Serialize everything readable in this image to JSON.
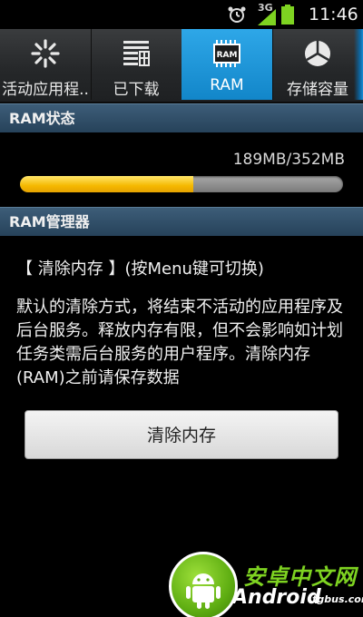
{
  "status_bar": {
    "network": "3G",
    "time": "11:46",
    "icons": [
      "alarm-clock-icon",
      "signal-icon",
      "battery-icon"
    ]
  },
  "tabs": [
    {
      "label": "活动应用程..",
      "icon": "loading-spinner-icon",
      "active": false
    },
    {
      "label": "已下载",
      "icon": "downloaded-apps-icon",
      "active": false
    },
    {
      "label": "RAM",
      "icon": "ram-chip-icon",
      "icon_text": "RAM",
      "active": true
    },
    {
      "label": "存储容量",
      "icon": "pie-chart-icon",
      "active": false
    }
  ],
  "ram_status": {
    "header": "RAM状态",
    "usage_text": "189MB/352MB",
    "used_mb": 189,
    "total_mb": 352
  },
  "ram_manager": {
    "header": "RAM管理器",
    "mode_line": "【 清除内存 】(按Menu键可切换)",
    "description": "默认的清除方式，将结束不活动的应用程序及后台服务。释放内存有限，但不会影响如计划任务类需后台服务的用户程序。清除内存(RAM)之前请保存数据",
    "button_label": "清除内存"
  },
  "watermark": {
    "cn": "安卓中文网",
    "en": "Android",
    "sub": ".tgbus.com"
  },
  "colors": {
    "accent_tab": "#1a95d9",
    "progress_fill": "#f5b800",
    "section_header": "#2f4d66",
    "watermark_green": "#7ed321"
  }
}
